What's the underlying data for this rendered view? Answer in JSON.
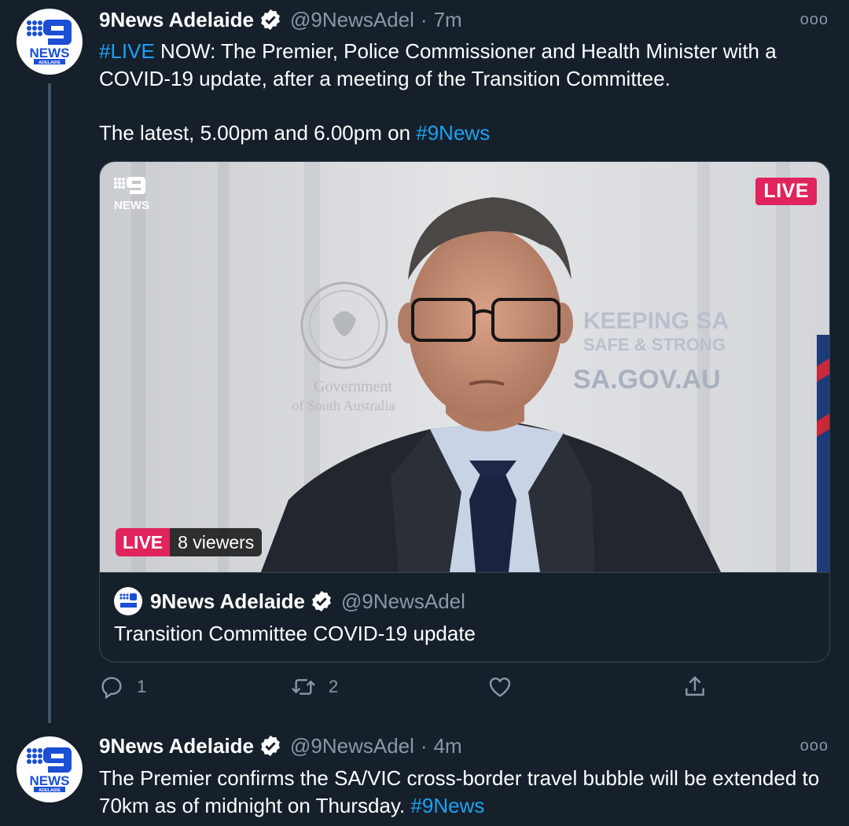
{
  "tweets": [
    {
      "name": "9News Adelaide",
      "handle": "@9NewsAdel",
      "separator": "·",
      "time": "7m",
      "more": "ooo",
      "text": {
        "hashtag_live": "#LIVE",
        "line1_rest": " NOW: The Premier, Police Commissioner and Health Minister with a COVID-19 update, after a meeting of the Transition Committee.",
        "line2_prefix": "The latest, 5.00pm and 6.00pm on ",
        "hashtag_9news": "#9News"
      },
      "card": {
        "badge_corner": "LIVE",
        "badge_live": "LIVE",
        "viewers": "8 viewers",
        "watermark_lines": [
          "9",
          "NEWS"
        ],
        "backdrop_text": [
          "KEEPING SA",
          "SAFE & STRONG",
          "SA.GOV.AU",
          "Government",
          "of South Australia"
        ],
        "author_name": "9News Adelaide",
        "author_handle": "@9NewsAdel",
        "title": "Transition Committee COVID-19 update"
      },
      "actions": {
        "reply_count": "1",
        "retweet_count": "2"
      }
    },
    {
      "name": "9News Adelaide",
      "handle": "@9NewsAdel",
      "separator": "·",
      "time": "4m",
      "more": "ooo",
      "text": {
        "body": "The Premier confirms the SA/VIC cross-border travel bubble will be extended to 70km as of midnight on Thursday. ",
        "hashtag_9news": "#9News"
      }
    }
  ],
  "avatar_text": {
    "top": "9",
    "middle": "NEWS",
    "bottom": "ADELAIDE"
  },
  "colors": {
    "background": "#15202b",
    "link": "#1da1f2",
    "muted": "#8899a6",
    "live_red": "#e0245e",
    "brand_blue": "#1a4fd6"
  }
}
